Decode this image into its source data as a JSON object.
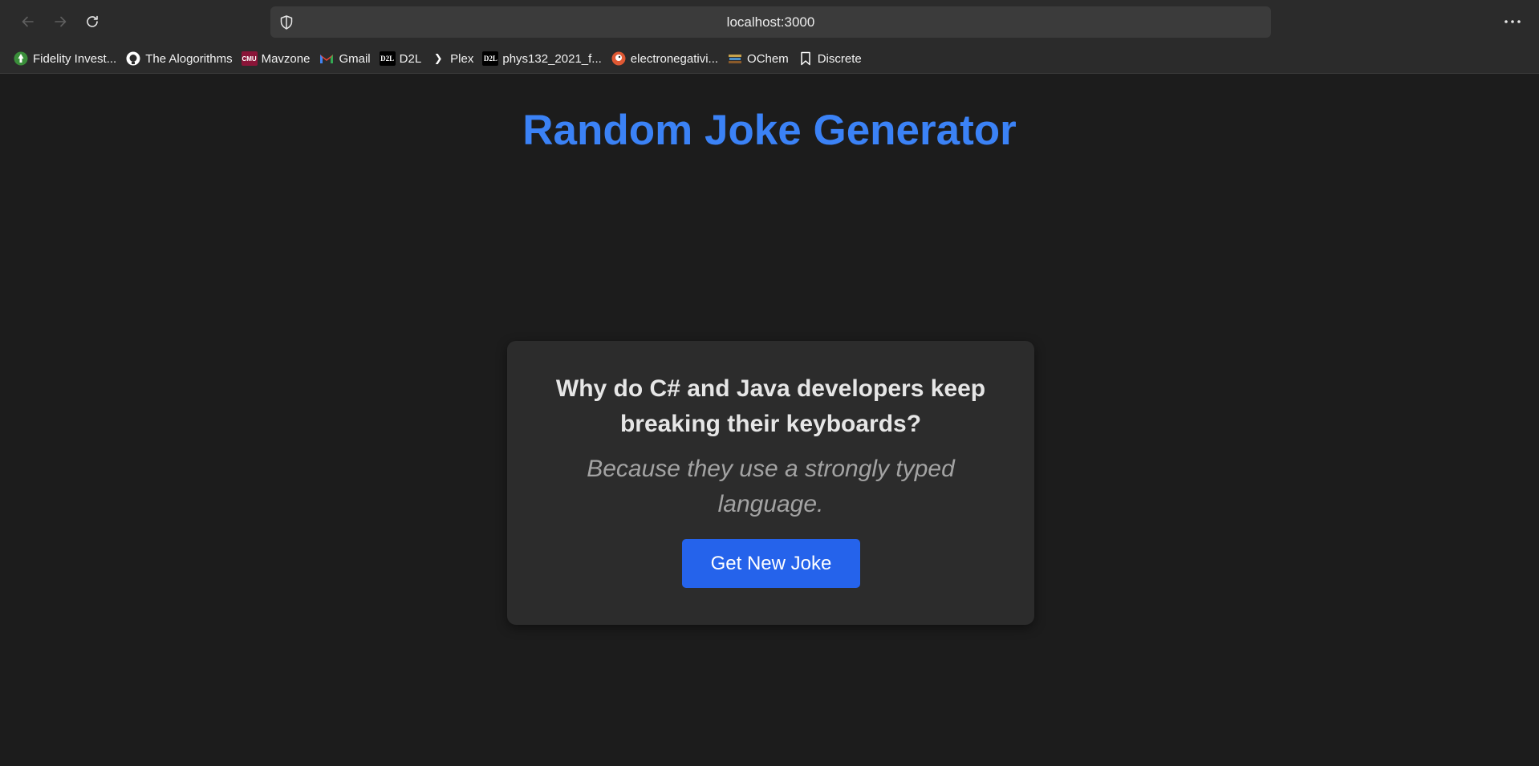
{
  "browser": {
    "address": "localhost:3000",
    "icons": {
      "back": "arrow-left-icon",
      "forward": "arrow-right-icon",
      "reload": "reload-icon",
      "shield": "shield-icon",
      "menu": "more-horizontal-icon"
    }
  },
  "bookmarks": [
    {
      "label": "Fidelity Invest...",
      "icon": "fidelity-icon",
      "icon_text": "",
      "icon_color": "#3a8e3a"
    },
    {
      "label": "The Alogorithms",
      "icon": "github-icon",
      "icon_text": "",
      "icon_color": "#ffffff"
    },
    {
      "label": "Mavzone",
      "icon": "cmu-icon",
      "icon_text": "CMU",
      "icon_color": "#8a1538"
    },
    {
      "label": "Gmail",
      "icon": "gmail-icon",
      "icon_text": "M",
      "icon_color": "#ea4335"
    },
    {
      "label": "D2L",
      "icon": "d2l-icon",
      "icon_text": "D2L",
      "icon_color": "#000000"
    },
    {
      "label": "Plex",
      "icon": "plex-icon",
      "icon_text": "❯",
      "icon_color": "#2b2b2b"
    },
    {
      "label": "phys132_2021_f...",
      "icon": "d2l-icon",
      "icon_text": "D2L",
      "icon_color": "#000000"
    },
    {
      "label": "electronegativi...",
      "icon": "duckduckgo-icon",
      "icon_text": "",
      "icon_color": "#de5833"
    },
    {
      "label": "OChem",
      "icon": "books-icon",
      "icon_text": "",
      "icon_color": "#c8a24a"
    },
    {
      "label": "Discrete",
      "icon": "bookmark-icon",
      "icon_text": "",
      "icon_color": "#ffffff"
    }
  ],
  "page": {
    "title": "Random Joke Generator",
    "joke": {
      "setup": "Why do C# and Java developers keep breaking their keyboards?",
      "punchline": "Because they use a strongly typed language."
    },
    "button_label": "Get New Joke"
  },
  "colors": {
    "accent": "#3b82f6",
    "button": "#2563eb",
    "background": "#1c1c1c",
    "card": "#2c2c2c"
  }
}
